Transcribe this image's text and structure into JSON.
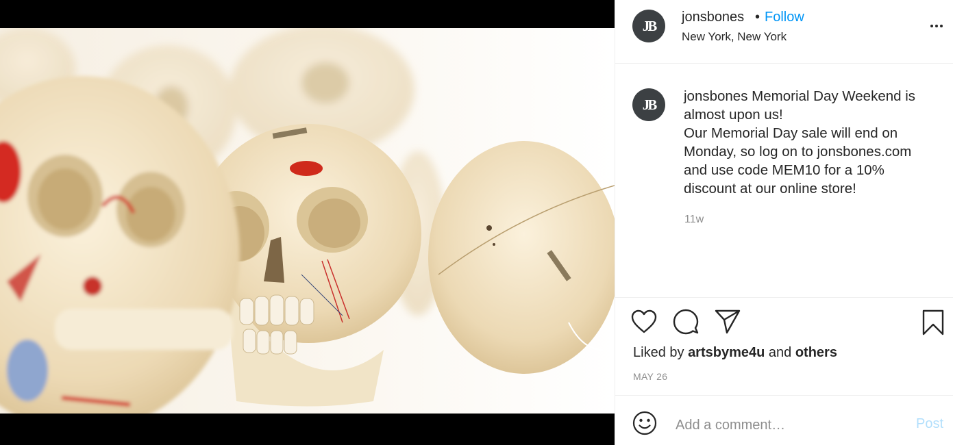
{
  "post": {
    "username": "jonsbones",
    "dot": "•",
    "follow_label": "Follow",
    "location": "New York, New York",
    "avatar_initials": "JB",
    "caption_username": "jonsbones",
    "caption_text": " Memorial Day Weekend is almost upon us!\nOur Memorial Day sale will end on Monday, so log on to jonsbones.com and use code MEM10 for a 10% discount at our online store!",
    "time_ago": "11w",
    "likes_prefix": "Liked by ",
    "liked_by_user": "artsbyme4u",
    "likes_middle": " and ",
    "likes_others": "others",
    "date": "MAY 26"
  },
  "comment": {
    "placeholder": "Add a comment…",
    "post_label": "Post"
  },
  "icons": {
    "more": "more-options-icon",
    "like": "heart-icon",
    "comment": "comment-icon",
    "share": "share-icon",
    "save": "bookmark-icon",
    "emoji": "emoji-icon"
  },
  "colors": {
    "accent": "#0095f6",
    "post_disabled": "#b2dffc",
    "secondary_text": "#8e8e8e",
    "avatar_bg": "#3c4043"
  }
}
